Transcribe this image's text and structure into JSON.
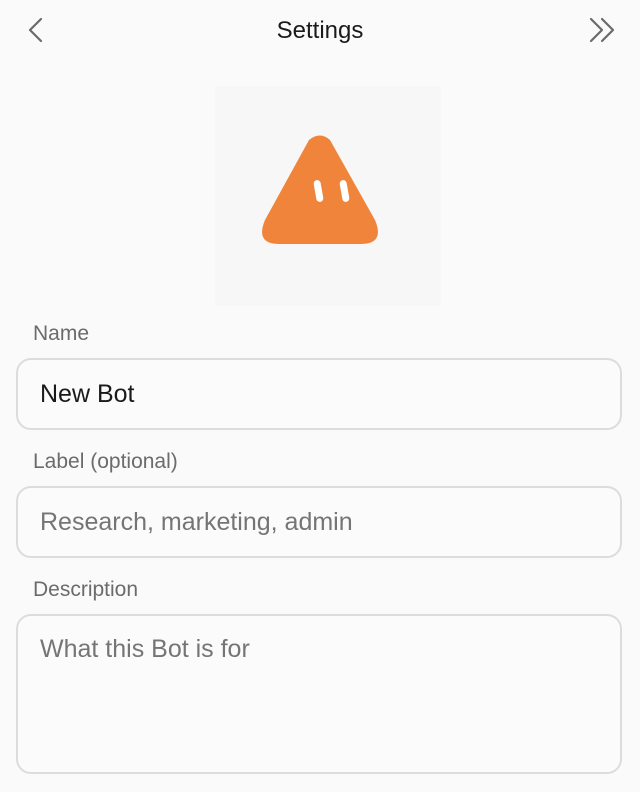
{
  "header": {
    "title": "Settings",
    "back_icon": "chevron-left-icon",
    "forward_icon": "double-chevron-right-icon"
  },
  "avatar": {
    "icon": "orange-triangle-bot-icon",
    "color": "#f0843a"
  },
  "form": {
    "name": {
      "label": "Name",
      "value": "New Bot"
    },
    "label": {
      "label": "Label (optional)",
      "placeholder": "Research, marketing, admin"
    },
    "description": {
      "label": "Description",
      "placeholder": "What this Bot is for"
    }
  }
}
